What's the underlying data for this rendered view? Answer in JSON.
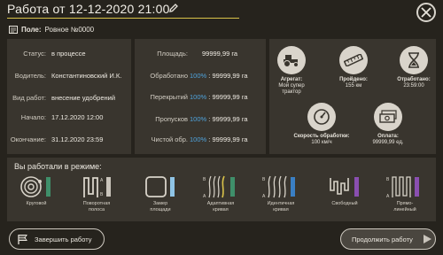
{
  "header": {
    "title": "Работа от 12-12-2020 21:00"
  },
  "field": {
    "label": "Поле:",
    "value": "Ровное №0000"
  },
  "info": [
    {
      "key": "Статус:",
      "value": "в процессе"
    },
    {
      "key": "Водитель:",
      "value": "Константиновский И.К."
    },
    {
      "key": "Вид работ:",
      "value": "внесение удобрений"
    },
    {
      "key": "Начало:",
      "value": "17.12.2020 12:00"
    },
    {
      "key": "Окончание:",
      "value": "31.12.2020 23:59"
    }
  ],
  "areas": [
    {
      "key": "Площадь:",
      "pct": "",
      "value": "99999,99 га"
    },
    {
      "key": "Обработано",
      "pct": "100%",
      "value": ": 99999,99 га"
    },
    {
      "key": "Перекрытий",
      "pct": "100%",
      "value": ": 99999,99 га"
    },
    {
      "key": "Пропусков",
      "pct": "100%",
      "value": ": 99999,99 га"
    },
    {
      "key": "Чистой обр.",
      "pct": "100%",
      "value": ": 99999,99 га"
    }
  ],
  "stats": {
    "aggregate": {
      "label": "Агрегат:",
      "value1": "Мой супер",
      "value2": "трактор",
      "icon": "tractor-icon"
    },
    "distance": {
      "label": "Пройдено:",
      "value": "155 км",
      "icon": "ruler-icon"
    },
    "worked": {
      "label": "Отработано:",
      "value": "23:59:00",
      "icon": "hourglass-icon"
    },
    "speed": {
      "label": "Скорость обработки:",
      "value": "100 км/ч",
      "icon": "speedometer-icon"
    },
    "payment": {
      "label": "Оплата:",
      "value": "99999,99 ед.",
      "icon": "money-icon"
    }
  },
  "modes": {
    "title": "Вы работали в режиме:",
    "items": [
      {
        "line1": "Круговой",
        "line2": "",
        "bar_color": "#3f8f6a"
      },
      {
        "line1": "Поворотная",
        "line2": "полоса",
        "bar_color": "#c9c4bb"
      },
      {
        "line1": "Замер",
        "line2": "площади",
        "bar_color": "#8fc4e6"
      },
      {
        "line1": "Адаптивная",
        "line2": "кривая",
        "bar_color": "#3f8f6a"
      },
      {
        "line1": "Идентичная",
        "line2": "кривая",
        "bar_color": "#3a7fc4"
      },
      {
        "line1": "Свободный",
        "line2": "",
        "bar_color": "#8a4fb0"
      },
      {
        "line1": "Прямо-",
        "line2": "линейный",
        "bar_color": "#8a4fb0"
      }
    ]
  },
  "buttons": {
    "finish": "Завершить работу",
    "continue": "Продолжить работу"
  },
  "colors": {
    "accent_yellow": "#d9c24a",
    "accent_blue": "#4fa3dc",
    "panel": "#39352e",
    "background": "#26231d"
  }
}
